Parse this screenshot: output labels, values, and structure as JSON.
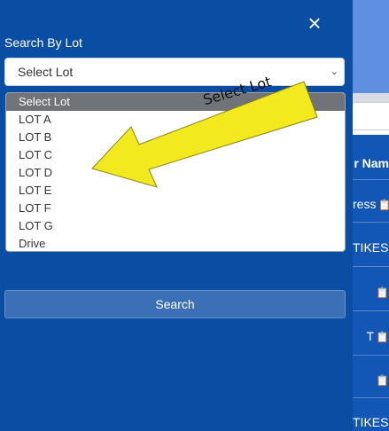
{
  "panel": {
    "close_icon": "×",
    "label": "Search By Lot",
    "select_value": "Select Lot",
    "options": [
      "Select Lot",
      "LOT A",
      "LOT B",
      "LOT C",
      "LOT D",
      "LOT E",
      "LOT F",
      "LOT G",
      "Drive"
    ],
    "search_label": "Search"
  },
  "annotation": {
    "text": "Select Lot"
  },
  "background_table": {
    "header": "r Nam",
    "rows": [
      "ress",
      "TIKES",
      "",
      "T",
      "",
      "TIKES"
    ]
  },
  "colors": {
    "panel_bg": "#0a4ea3",
    "arrow": "#f2ea1e",
    "selected_option": "#707378",
    "button": "#3b6fb6"
  }
}
